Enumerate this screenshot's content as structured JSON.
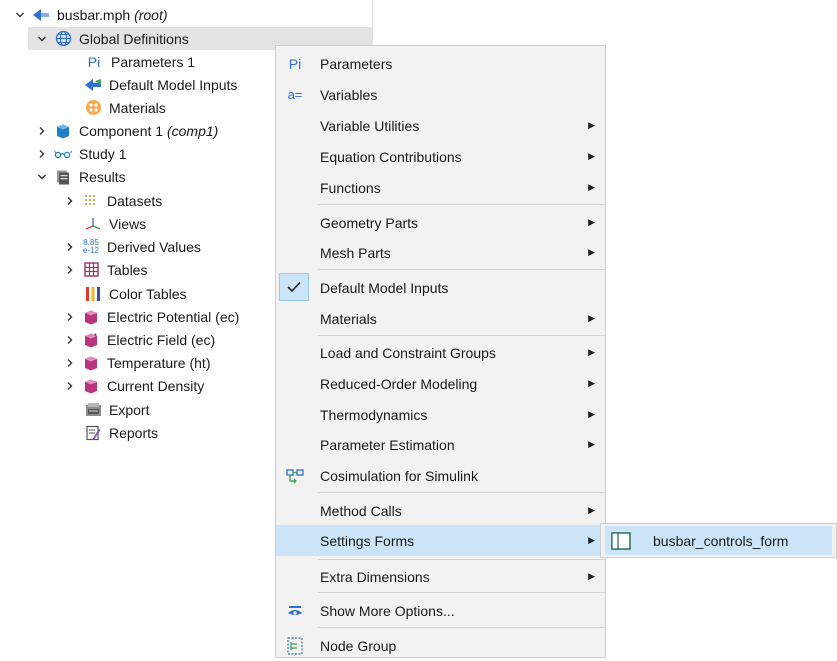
{
  "tree": {
    "root": {
      "name": "busbar.mph",
      "suffix": "(root)"
    },
    "global_definitions": "Global Definitions",
    "parameters": "Parameters 1",
    "default_model_inputs": "Default Model Inputs",
    "materials": "Materials",
    "component": {
      "name": "Component 1",
      "suffix": "(comp1)"
    },
    "study": "Study 1",
    "results": "Results",
    "datasets": "Datasets",
    "views": "Views",
    "derived_values": "Derived Values",
    "tables": "Tables",
    "color_tables": "Color Tables",
    "electric_potential": "Electric Potential (ec)",
    "electric_field": "Electric Field (ec)",
    "temperature": "Temperature (ht)",
    "current_density": "Current Density",
    "export": "Export",
    "reports": "Reports"
  },
  "menu": {
    "parameters": "Parameters",
    "variables": "Variables",
    "variable_utilities": "Variable Utilities",
    "equation_contributions": "Equation Contributions",
    "functions": "Functions",
    "geometry_parts": "Geometry Parts",
    "mesh_parts": "Mesh Parts",
    "default_model_inputs": "Default Model Inputs",
    "materials": "Materials",
    "load_constraint_groups": "Load and Constraint Groups",
    "reduced_order_modeling": "Reduced-Order Modeling",
    "thermodynamics": "Thermodynamics",
    "parameter_estimation": "Parameter Estimation",
    "cosimulation": "Cosimulation for Simulink",
    "method_calls": "Method Calls",
    "settings_forms": "Settings Forms",
    "extra_dimensions": "Extra Dimensions",
    "show_more_options": "Show More Options...",
    "node_group": "Node Group"
  },
  "submenu": {
    "busbar_controls_form": "busbar_controls_form"
  },
  "icons": {
    "parameters_glyph": "Pi",
    "variables_glyph": "a=",
    "derived_values_top": "8.85",
    "derived_values_bottom": "e-12"
  }
}
